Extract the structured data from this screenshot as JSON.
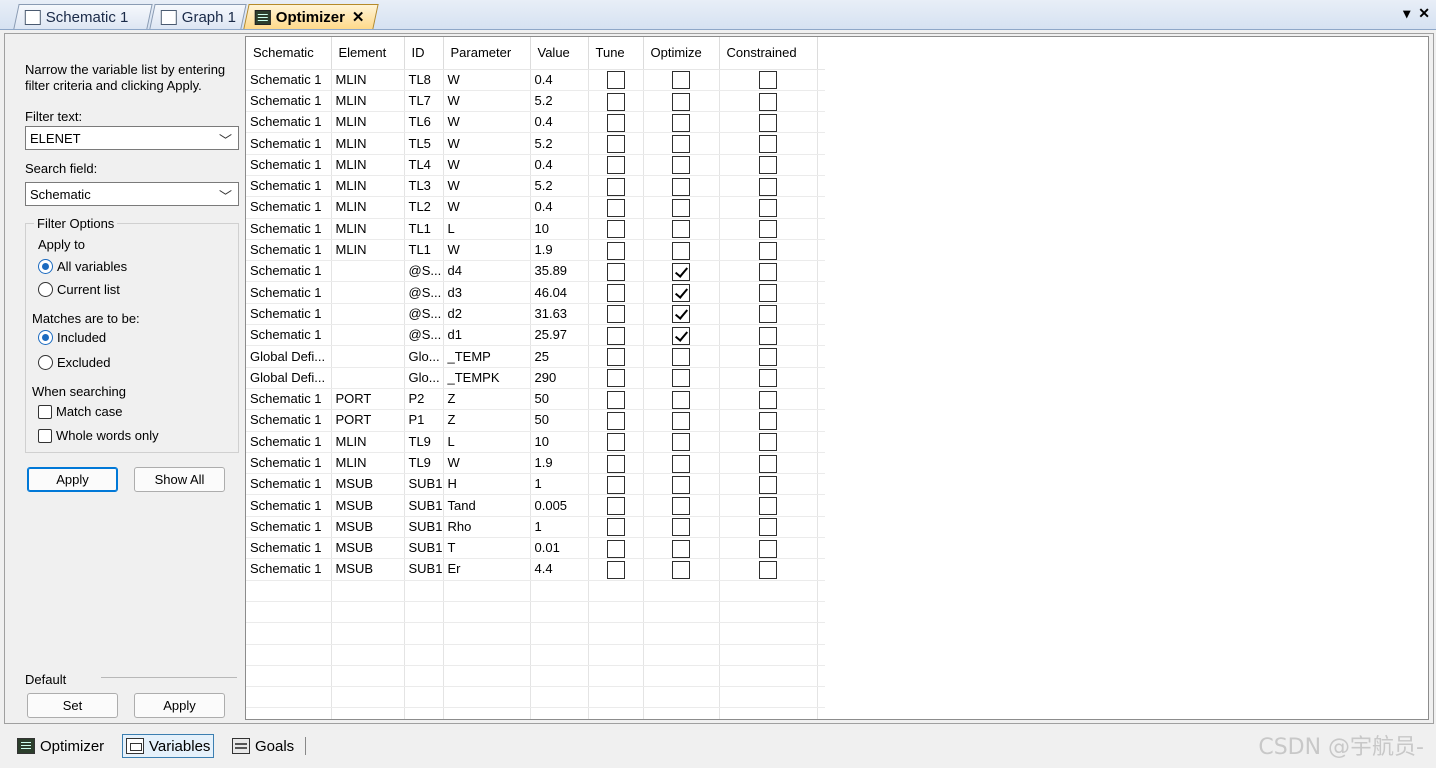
{
  "doc_tabs": [
    {
      "label": "Schematic 1",
      "icon": "schematic-icon",
      "active": false
    },
    {
      "label": "Graph 1",
      "icon": "graph-icon",
      "active": false
    },
    {
      "label": "Optimizer",
      "icon": "optimizer-icon",
      "active": true
    }
  ],
  "window_controls": {
    "menu": "▾",
    "close": "✕"
  },
  "filter": {
    "intro": "Narrow the variable list by entering filter criteria and clicking Apply.",
    "filter_text_label": "Filter text:",
    "filter_text_value": "ELENET",
    "search_field_label": "Search field:",
    "search_field_value": "Schematic",
    "options_legend": "Filter Options",
    "apply_to_label": "Apply to",
    "apply_to": [
      {
        "label": "All variables",
        "selected": true
      },
      {
        "label": "Current list",
        "selected": false
      }
    ],
    "matches_label": "Matches are to be:",
    "matches": [
      {
        "label": "Included",
        "selected": true
      },
      {
        "label": "Excluded",
        "selected": false
      }
    ],
    "when_searching_label": "When searching",
    "search_opts": [
      {
        "label": "Match case",
        "checked": false
      },
      {
        "label": "Whole words only",
        "checked": false
      }
    ],
    "apply_button": "Apply",
    "show_all_button": "Show All",
    "default_label": "Default",
    "set_button": "Set",
    "default_apply_button": "Apply"
  },
  "grid": {
    "columns": [
      "Schematic",
      "Element",
      "ID",
      "Parameter",
      "Value",
      "Tune",
      "Optimize",
      "Constrained"
    ],
    "rows": [
      {
        "schematic": "Schematic 1",
        "element": "MLIN",
        "id": "TL8",
        "parameter": "W",
        "value": "0.4",
        "tune": false,
        "optimize": false,
        "constrained": false
      },
      {
        "schematic": "Schematic 1",
        "element": "MLIN",
        "id": "TL7",
        "parameter": "W",
        "value": "5.2",
        "tune": false,
        "optimize": false,
        "constrained": false
      },
      {
        "schematic": "Schematic 1",
        "element": "MLIN",
        "id": "TL6",
        "parameter": "W",
        "value": "0.4",
        "tune": false,
        "optimize": false,
        "constrained": false
      },
      {
        "schematic": "Schematic 1",
        "element": "MLIN",
        "id": "TL5",
        "parameter": "W",
        "value": "5.2",
        "tune": false,
        "optimize": false,
        "constrained": false
      },
      {
        "schematic": "Schematic 1",
        "element": "MLIN",
        "id": "TL4",
        "parameter": "W",
        "value": "0.4",
        "tune": false,
        "optimize": false,
        "constrained": false
      },
      {
        "schematic": "Schematic 1",
        "element": "MLIN",
        "id": "TL3",
        "parameter": "W",
        "value": "5.2",
        "tune": false,
        "optimize": false,
        "constrained": false
      },
      {
        "schematic": "Schematic 1",
        "element": "MLIN",
        "id": "TL2",
        "parameter": "W",
        "value": "0.4",
        "tune": false,
        "optimize": false,
        "constrained": false
      },
      {
        "schematic": "Schematic 1",
        "element": "MLIN",
        "id": "TL1",
        "parameter": "L",
        "value": "10",
        "tune": false,
        "optimize": false,
        "constrained": false
      },
      {
        "schematic": "Schematic 1",
        "element": "MLIN",
        "id": "TL1",
        "parameter": "W",
        "value": "1.9",
        "tune": false,
        "optimize": false,
        "constrained": false
      },
      {
        "schematic": "Schematic 1",
        "element": "",
        "id": "@S...",
        "parameter": "d4",
        "value": "35.89",
        "tune": false,
        "optimize": true,
        "constrained": false
      },
      {
        "schematic": "Schematic 1",
        "element": "",
        "id": "@S...",
        "parameter": "d3",
        "value": "46.04",
        "tune": false,
        "optimize": true,
        "constrained": false
      },
      {
        "schematic": "Schematic 1",
        "element": "",
        "id": "@S...",
        "parameter": "d2",
        "value": "31.63",
        "tune": false,
        "optimize": true,
        "constrained": false
      },
      {
        "schematic": "Schematic 1",
        "element": "",
        "id": "@S...",
        "parameter": "d1",
        "value": "25.97",
        "tune": false,
        "optimize": true,
        "constrained": false
      },
      {
        "schematic": "Global Defi...",
        "element": "",
        "id": "Glo...",
        "parameter": "_TEMP",
        "value": "25",
        "tune": false,
        "optimize": false,
        "constrained": false
      },
      {
        "schematic": "Global Defi...",
        "element": "",
        "id": "Glo...",
        "parameter": "_TEMPK",
        "value": "290",
        "tune": false,
        "optimize": false,
        "constrained": false
      },
      {
        "schematic": "Schematic 1",
        "element": "PORT",
        "id": "P2",
        "parameter": "Z",
        "value": "50",
        "tune": false,
        "optimize": false,
        "constrained": false
      },
      {
        "schematic": "Schematic 1",
        "element": "PORT",
        "id": "P1",
        "parameter": "Z",
        "value": "50",
        "tune": false,
        "optimize": false,
        "constrained": false
      },
      {
        "schematic": "Schematic 1",
        "element": "MLIN",
        "id": "TL9",
        "parameter": "L",
        "value": "10",
        "tune": false,
        "optimize": false,
        "constrained": false
      },
      {
        "schematic": "Schematic 1",
        "element": "MLIN",
        "id": "TL9",
        "parameter": "W",
        "value": "1.9",
        "tune": false,
        "optimize": false,
        "constrained": false
      },
      {
        "schematic": "Schematic 1",
        "element": "MSUB",
        "id": "SUB1",
        "parameter": "H",
        "value": "1",
        "tune": false,
        "optimize": false,
        "constrained": false
      },
      {
        "schematic": "Schematic 1",
        "element": "MSUB",
        "id": "SUB1",
        "parameter": "Tand",
        "value": "0.005",
        "tune": false,
        "optimize": false,
        "constrained": false
      },
      {
        "schematic": "Schematic 1",
        "element": "MSUB",
        "id": "SUB1",
        "parameter": "Rho",
        "value": "1",
        "tune": false,
        "optimize": false,
        "constrained": false
      },
      {
        "schematic": "Schematic 1",
        "element": "MSUB",
        "id": "SUB1",
        "parameter": "T",
        "value": "0.01",
        "tune": false,
        "optimize": false,
        "constrained": false
      },
      {
        "schematic": "Schematic 1",
        "element": "MSUB",
        "id": "SUB1",
        "parameter": "Er",
        "value": "4.4",
        "tune": false,
        "optimize": false,
        "constrained": false
      }
    ],
    "empty_rows": 7
  },
  "bottom_tabs": [
    {
      "label": "Optimizer",
      "icon": "optimizer-icon",
      "active": false
    },
    {
      "label": "Variables",
      "icon": "variables-icon",
      "active": true
    },
    {
      "label": "Goals",
      "icon": "goals-icon",
      "active": false
    }
  ],
  "watermark": "CSDN @宇航员-"
}
